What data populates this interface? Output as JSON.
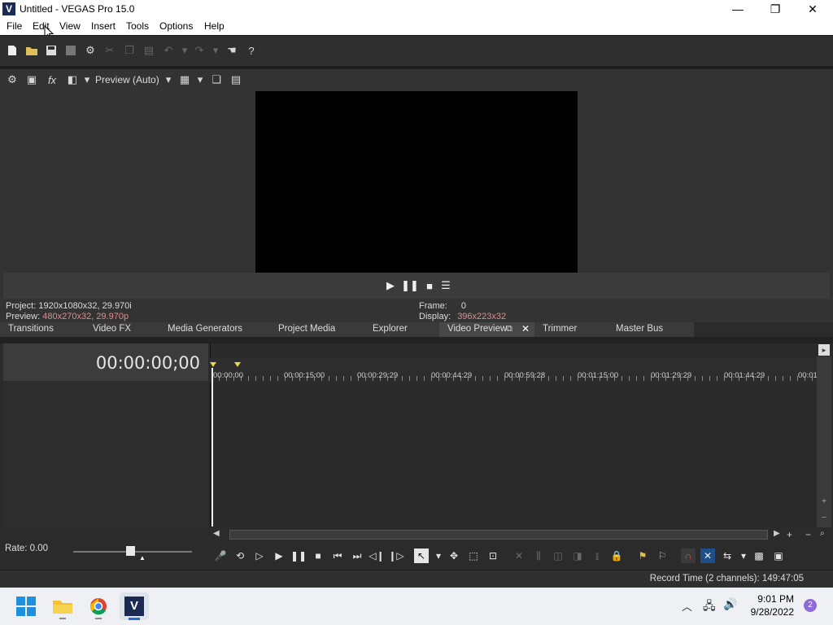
{
  "window": {
    "title": "Untitled - VEGAS Pro 15.0",
    "logo_letter": "V",
    "minimize": "—",
    "maximize": "❐",
    "close": "✕"
  },
  "menu": [
    "File",
    "Edit",
    "View",
    "Insert",
    "Tools",
    "Options",
    "Help"
  ],
  "preview": {
    "quality_label": "Preview (Auto)",
    "project_label": "Project:",
    "project_value": "1920x1080x32, 29.970i",
    "preview_label": "Preview:",
    "preview_value": "480x270x32, 29.970p",
    "frame_label": "Frame:",
    "frame_value": "0",
    "display_label": "Display:",
    "display_value": "396x223x32"
  },
  "tabs": [
    "Transitions",
    "Video FX",
    "Media Generators",
    "Project Media",
    "Explorer",
    "Video Preview",
    "Trimmer",
    "Master Bus"
  ],
  "timeline": {
    "timecode": "00:00:00;00",
    "ruler": [
      "00:00:00",
      "00:00:15:00",
      "00:00:29:29",
      "00:00:44:29",
      "00:00:59:28",
      "00:01:15:00",
      "00:01:29:29",
      "00:01:44:29",
      "00:01"
    ]
  },
  "rate": {
    "label": "Rate: 0.00",
    "value": 0.0
  },
  "status": {
    "record_time": "Record Time (2 channels): 149:47:05"
  },
  "taskbar": {
    "time": "9:01 PM",
    "date": "9/28/2022",
    "notification_count": "2"
  },
  "colors": {
    "accent_red_text": "#e58a8a",
    "panel_bg": "#2b2b2b",
    "preview_bg": "#000000"
  }
}
